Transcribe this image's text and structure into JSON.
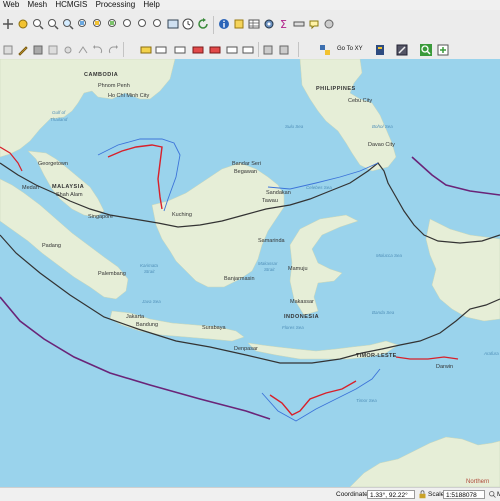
{
  "menu": [
    "Web",
    "Mesh",
    "HCMGIS",
    "Processing",
    "Help"
  ],
  "toolbar": {
    "goto_label": "Go To XY"
  },
  "map": {
    "countries": [
      {
        "key": "cambodia",
        "label": "CAMBODIA"
      },
      {
        "key": "philippines",
        "label": "PHILIPPINES"
      },
      {
        "key": "malaysia",
        "label": "MALAYSIA"
      },
      {
        "key": "indonesia",
        "label": "INDONESIA"
      },
      {
        "key": "timor_leste",
        "label": "TIMOR-LESTE"
      }
    ],
    "cities": [
      {
        "key": "phnom_penh",
        "label": "Phnom Penh"
      },
      {
        "key": "ho_chi_minh",
        "label": "Ho Chi Minh City"
      },
      {
        "key": "cebu",
        "label": "Cebu City"
      },
      {
        "key": "davao",
        "label": "Davao City"
      },
      {
        "key": "bandar",
        "label": "Bandar Seri"
      },
      {
        "key": "begawan",
        "label": "Begawan"
      },
      {
        "key": "georgetown",
        "label": "Georgetown"
      },
      {
        "key": "medan",
        "label": "Medan"
      },
      {
        "key": "shah_alam",
        "label": "Shah Alam"
      },
      {
        "key": "singapore",
        "label": "Singapore"
      },
      {
        "key": "kuching",
        "label": "Kuching"
      },
      {
        "key": "sandakan",
        "label": "Sandakan"
      },
      {
        "key": "tawau",
        "label": "Tawau"
      },
      {
        "key": "samarinda",
        "label": "Samarinda"
      },
      {
        "key": "padang",
        "label": "Padang"
      },
      {
        "key": "palembang",
        "label": "Palembang"
      },
      {
        "key": "banjarmasin",
        "label": "Banjarmasin"
      },
      {
        "key": "mamuju",
        "label": "Mamuju"
      },
      {
        "key": "makassar",
        "label": "Makassar"
      },
      {
        "key": "jakarta",
        "label": "Jakarta"
      },
      {
        "key": "bandung",
        "label": "Bandung"
      },
      {
        "key": "surabaya",
        "label": "Surabaya"
      },
      {
        "key": "denpasar",
        "label": "Denpasar"
      },
      {
        "key": "darwin",
        "label": "Darwin"
      }
    ],
    "seas": [
      {
        "key": "gulf_thailand_1",
        "label": "Gulf of"
      },
      {
        "key": "gulf_thailand_2",
        "label": "Thailand"
      },
      {
        "key": "sulu",
        "label": "Sulu Sea"
      },
      {
        "key": "celebes",
        "label": "Celebes Sea"
      },
      {
        "key": "java",
        "label": "Java Sea"
      },
      {
        "key": "flores",
        "label": "Flores Sea"
      },
      {
        "key": "banda",
        "label": "Banda Sea"
      },
      {
        "key": "timor",
        "label": "Timor Sea"
      },
      {
        "key": "molucca",
        "label": "Molucca Sea"
      },
      {
        "key": "bohol",
        "label": "Bohol Sea"
      },
      {
        "key": "karimata_1",
        "label": "Karimata"
      },
      {
        "key": "karimata_2",
        "label": "Strait"
      },
      {
        "key": "makassar_strait_1",
        "label": "Makassar"
      },
      {
        "key": "makassar_strait_2",
        "label": "Strait"
      },
      {
        "key": "arafura",
        "label": "Arafura"
      },
      {
        "key": "northern",
        "label": "Northern"
      }
    ]
  },
  "status": {
    "coordinate_label": "Coordinate",
    "coordinate_value": "1.33°, 92.22°",
    "scale_label": "Scale",
    "scale_value": "1:5188078",
    "trailing": "Ma"
  },
  "colors": {
    "sea": "#9ad3ec",
    "land": "#e6eed7",
    "eez_red": "#d8202a",
    "eez_blue": "#3d74d9",
    "boundary_purple": "#6a2478",
    "boundary_dark": "#333333"
  }
}
